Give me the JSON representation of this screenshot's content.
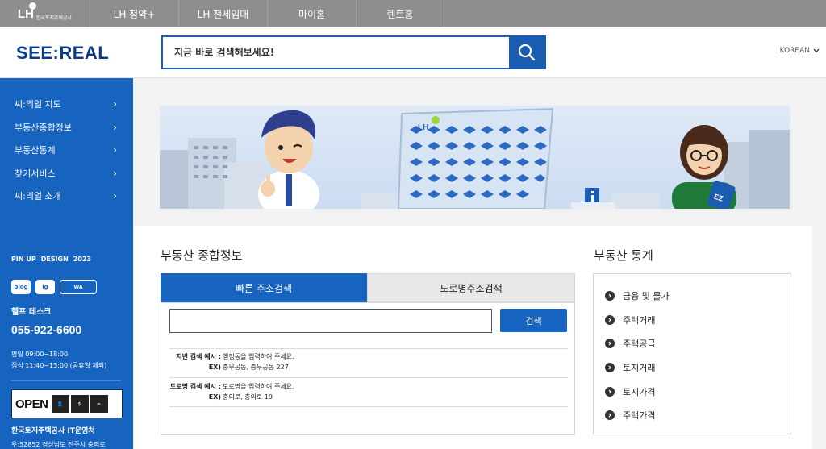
{
  "top_bar": {
    "logo_text": "LH",
    "logo_sub": "한국토지주택공사",
    "nav": [
      "LH 청약+",
      "LH 전세임대",
      "마이홈",
      "렌트홈"
    ]
  },
  "header": {
    "brand": "SEE:REAL",
    "search_placeholder": "지금 바로 검색해보세요!",
    "language": "KOREAN"
  },
  "sidebar": {
    "menu": [
      "씨:리얼 지도",
      "부동산종합정보",
      "부동산통계",
      "찾기서비스",
      "씨:리얼 소개"
    ],
    "awards": [
      "PIN UP",
      "DESIGN",
      "2023"
    ],
    "social": [
      "blog",
      "ig",
      "WA"
    ],
    "help_title": "헬프 데스크",
    "phone": "055-922-6600",
    "hours_weekday": "평일 09:00~18:00",
    "hours_lunch": "점심 11:40~13:00 (공휴일 제외)",
    "open_label": "OPEN",
    "company": "한국토지주택공사 IT운영처",
    "address": "우:52852 경상남도 진주시 충의로"
  },
  "main": {
    "banner_logo": "LH",
    "banner_sign": "EZ",
    "info_title": "부동산 종합정보",
    "tabs": [
      "빠른 주소검색",
      "도로명주소검색"
    ],
    "search_button": "검색",
    "examples": [
      {
        "label": "지번 검색 예시 :",
        "text": "행정동을 입력하여 주세요.",
        "ex_label": "EX)",
        "ex": "충무공동, 충무공동 227"
      },
      {
        "label": "도로명 검색 예시 :",
        "text": "도로명을 입력하여 주세요.",
        "ex_label": "EX)",
        "ex": "충의로, 충의로 19"
      }
    ],
    "stats_title": "부동산 통계",
    "stats": [
      "금융 및 물가",
      "주택거래",
      "주택공급",
      "토지거래",
      "토지가격",
      "주택가격"
    ]
  },
  "colors": {
    "primary": "#1764c0",
    "brand_text": "#0b3a8c",
    "topbar": "#8e8e8e"
  }
}
